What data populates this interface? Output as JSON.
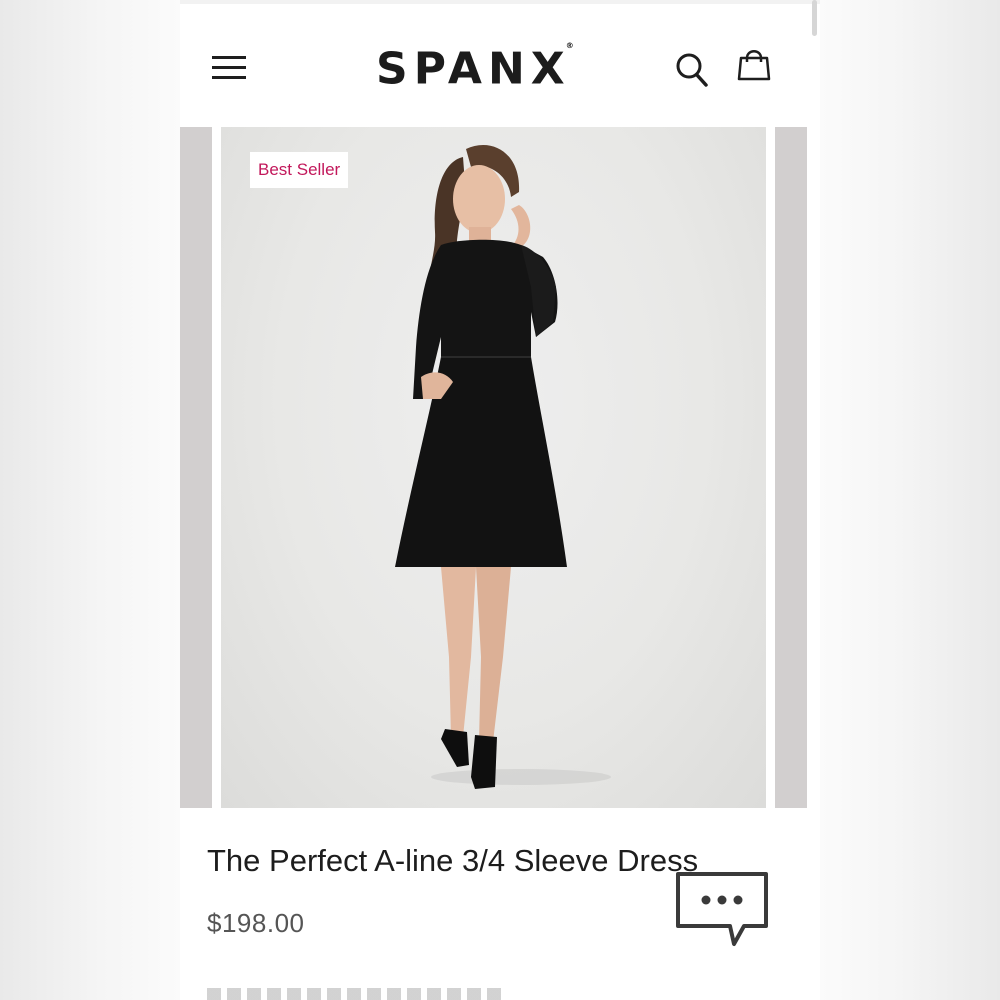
{
  "header": {
    "logo": "SPANX",
    "logo_mark": "®",
    "menu_icon": "hamburger-menu-icon",
    "search_icon": "search-icon",
    "bag_icon": "shopping-bag-icon"
  },
  "product": {
    "badge": "Best Seller",
    "badge_color": "#c2185b",
    "title": "The Perfect A-line 3/4 Sleeve Dress",
    "price": "$198.00",
    "image_icon": "product-photo-model-black-dress"
  },
  "chat": {
    "icon": "chat-bubble-icon"
  },
  "colors": {
    "accent": "#c2185b",
    "text": "#1d1d1d",
    "photo_bg": "#e8e8e6"
  }
}
